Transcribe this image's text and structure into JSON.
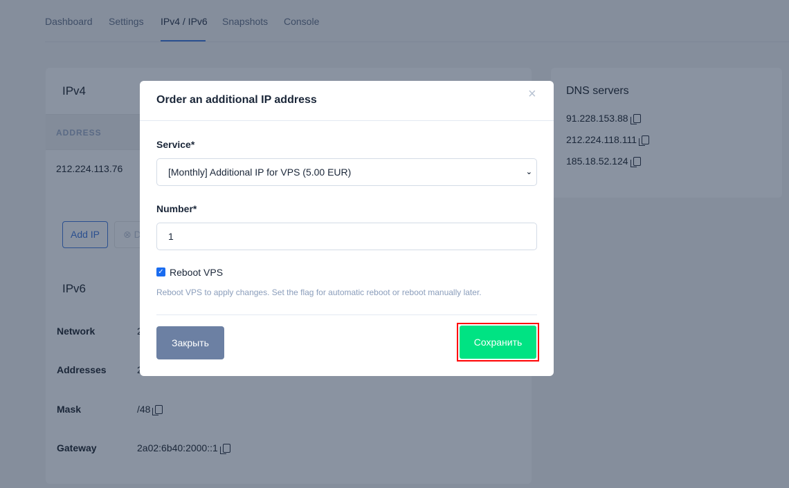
{
  "tabs": [
    {
      "label": "Dashboard"
    },
    {
      "label": "Settings"
    },
    {
      "label": "IPv4 / IPv6",
      "active": true
    },
    {
      "label": "Snapshots"
    },
    {
      "label": "Console"
    }
  ],
  "ipv4": {
    "title": "IPv4",
    "column_header": "ADDRESS",
    "rows": [
      "212.224.113.76"
    ],
    "add_button": "Add IP",
    "second_button_partial": "D"
  },
  "ipv6": {
    "title": "IPv6",
    "rows": [
      {
        "label": "Network",
        "value": "2"
      },
      {
        "label": "Addresses",
        "value": "2"
      },
      {
        "label": "Mask",
        "value": "/48"
      },
      {
        "label": "Gateway",
        "value": "2a02:6b40:2000::1"
      }
    ]
  },
  "dns": {
    "title": "DNS servers",
    "servers": [
      "91.228.153.88",
      "212.224.118.111",
      "185.18.52.124"
    ]
  },
  "modal": {
    "title": "Order an additional IP address",
    "close_icon": "×",
    "service_label": "Service*",
    "service_value": "[Monthly] Additional IP for VPS (5.00 EUR)",
    "number_label": "Number*",
    "number_value": "1",
    "reboot_label": "Reboot VPS",
    "reboot_checked": true,
    "help": "Reboot VPS to apply changes. Set the flag for automatic reboot or reboot manually later.",
    "close_button": "Закрыть",
    "save_button": "Сохранить"
  },
  "colors": {
    "save": "#00e383",
    "close": "#6c80a3",
    "highlight": "#ff0000",
    "tab_underline": "#2a4f8f"
  }
}
